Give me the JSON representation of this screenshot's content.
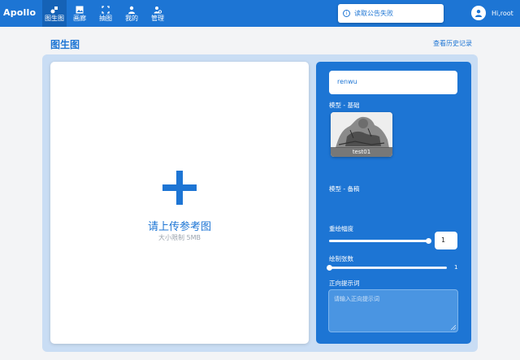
{
  "brand": "Apollo",
  "nav": [
    {
      "label": "图生图",
      "icon": "image-to-image-icon",
      "active": true
    },
    {
      "label": "画廊",
      "icon": "gallery-icon",
      "active": false
    },
    {
      "label": "抽图",
      "icon": "crop-icon",
      "active": false
    },
    {
      "label": "我的",
      "icon": "user-icon",
      "active": false
    },
    {
      "label": "管理",
      "icon": "manage-icon",
      "active": false
    }
  ],
  "notice": {
    "icon": "info-icon",
    "text": "读取公告失败"
  },
  "user": {
    "avatar_icon": "avatar-icon",
    "greeting": "Hi,root"
  },
  "page": {
    "title": "图生图",
    "history_link": "查看历史记录"
  },
  "upload": {
    "icon": "plus-icon",
    "title": "请上传参考图",
    "subtitle": "大小限制 5MB"
  },
  "settings": {
    "prompt_name_value": "renwu",
    "model_base_label": "模型 - 基础",
    "model_base_card": {
      "name": "test01"
    },
    "model_alt_label": "模型 - 备稿",
    "redraw_label": "重绘幅度",
    "redraw_value": "1",
    "redraw_level": 1.0,
    "count_label": "绘制张数",
    "count_value": "1",
    "count_level": 0.0,
    "positive_prompt_label": "正向提示词",
    "positive_prompt_placeholder": "请输入正向提示词"
  },
  "colors": {
    "accent": "#1d75d4",
    "panel_bg": "#c9ddf4",
    "page_bg": "#f3f4f6"
  }
}
